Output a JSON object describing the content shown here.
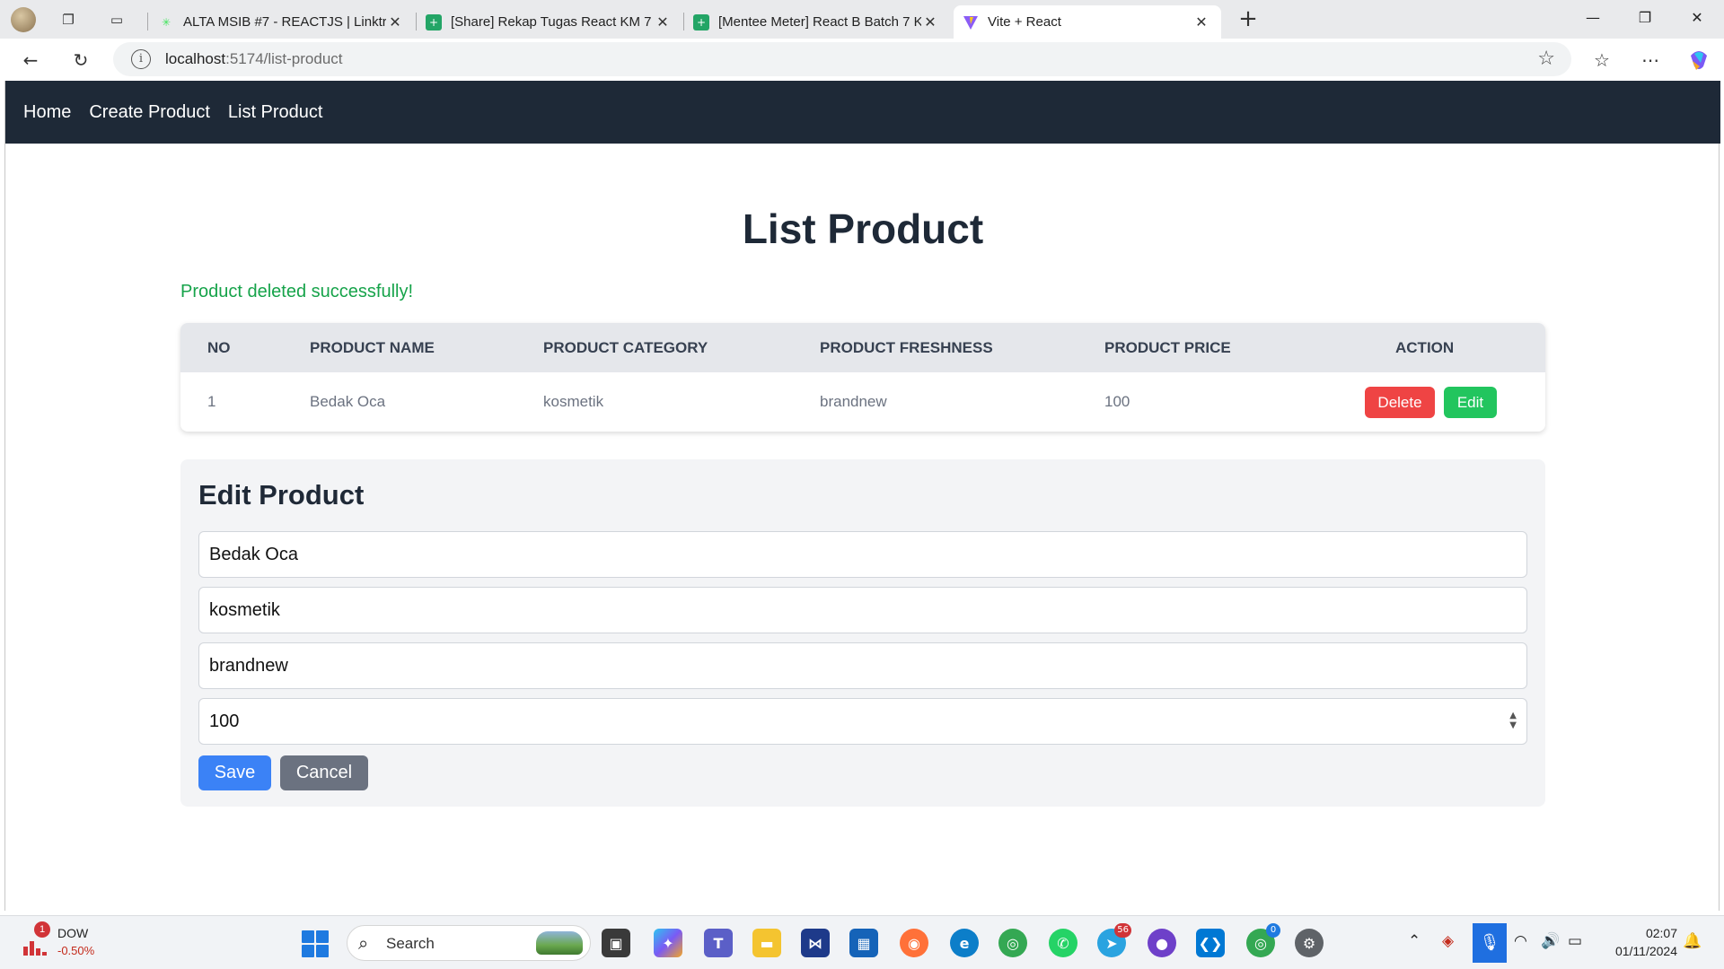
{
  "browser": {
    "tabs": [
      {
        "title": "ALTA MSIB #7 - REACTJS | Linktree",
        "icon": "linktree-icon",
        "active": false
      },
      {
        "title": "[Share] Rekap Tugas React KM 7 -",
        "icon": "sheets-icon",
        "active": false
      },
      {
        "title": "[Mentee Meter] React B Batch 7 K",
        "icon": "sheets-icon",
        "active": false
      },
      {
        "title": "Vite + React",
        "icon": "vite-icon",
        "active": true
      }
    ],
    "new_tab_glyph": "+",
    "url_host": "localhost",
    "url_path": ":5174/list-product"
  },
  "nav": {
    "links": [
      "Home",
      "Create Product",
      "List Product"
    ]
  },
  "page": {
    "title": "List Product",
    "success_message": "Product deleted successfully!"
  },
  "table": {
    "headers": [
      "NO",
      "PRODUCT NAME",
      "PRODUCT CATEGORY",
      "PRODUCT FRESHNESS",
      "PRODUCT PRICE",
      "ACTION"
    ],
    "rows": [
      {
        "no": "1",
        "name": "Bedak Oca",
        "category": "kosmetik",
        "freshness": "brandnew",
        "price": "100"
      }
    ],
    "delete_label": "Delete",
    "edit_label": "Edit"
  },
  "edit_form": {
    "title": "Edit Product",
    "name_value": "Bedak Oca",
    "category_value": "kosmetik",
    "freshness_value": "brandnew",
    "price_value": "100",
    "save_label": "Save",
    "cancel_label": "Cancel"
  },
  "taskbar": {
    "stock_badge": "1",
    "stock_name": "DOW",
    "stock_change": "-0.50%",
    "search_label": "Search",
    "telegram_badge": "56",
    "chrome_badge": "0",
    "time": "02:07",
    "date": "01/11/2024"
  },
  "colors": {
    "navbar": "#1e2937",
    "success": "#16a34a",
    "delete": "#ef4444",
    "edit": "#22c55e",
    "save": "#3b82f6",
    "cancel": "#6b7280"
  }
}
